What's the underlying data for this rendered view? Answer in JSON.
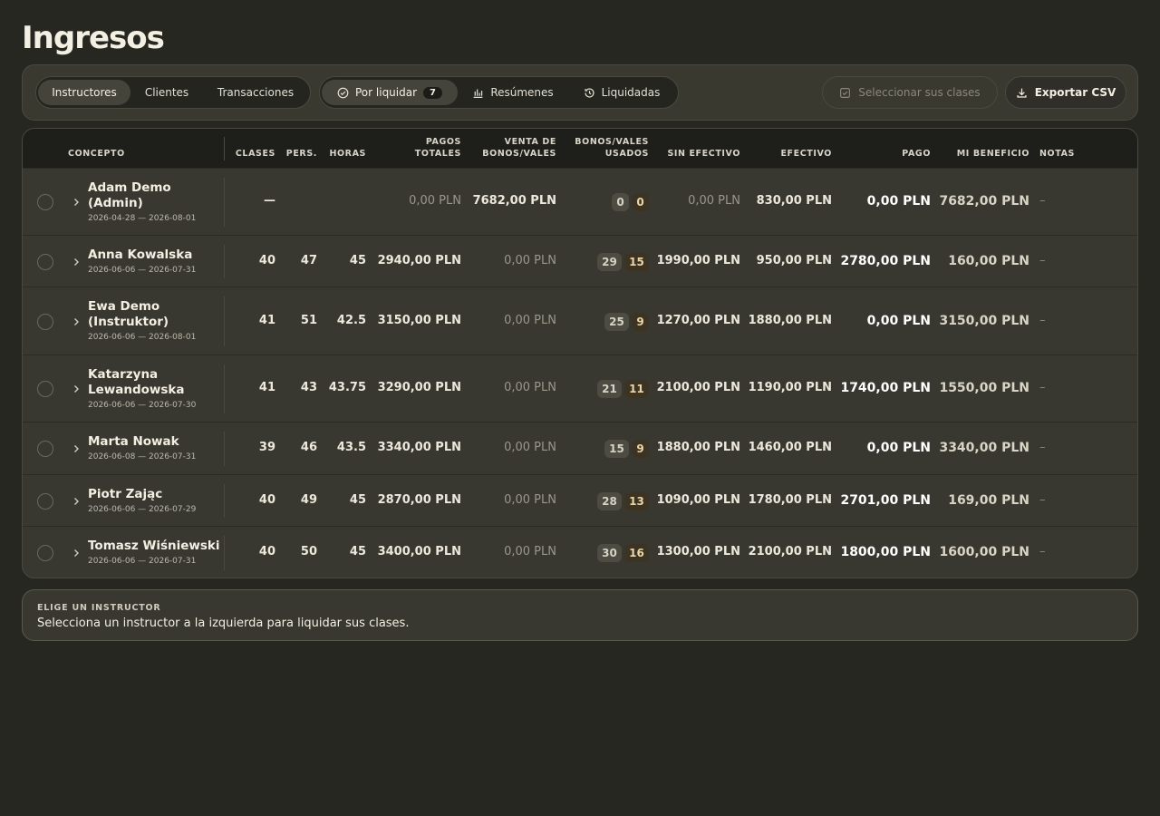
{
  "page": {
    "title": "Ingresos"
  },
  "tabs": {
    "view": [
      "Instructores",
      "Clientes",
      "Transacciones"
    ],
    "status": [
      {
        "label": "Por liquidar",
        "icon": "check-circle-icon",
        "count": "7"
      },
      {
        "label": "Resúmenes",
        "icon": "bar-chart-icon"
      },
      {
        "label": "Liquidadas",
        "icon": "history-icon"
      }
    ]
  },
  "actions": {
    "select_label": "Seleccionar sus clases",
    "export_label": "Exportar CSV"
  },
  "table": {
    "headers": {
      "concepto": "CONCEPTO",
      "clases": "CLASES",
      "pers": "PERS.",
      "horas": "HORAS",
      "pagos": [
        "PAGOS",
        "TOTALES"
      ],
      "venta": [
        "VENTA DE",
        "BONOS/VALES"
      ],
      "usados": [
        "BONOS/VALES",
        "USADOS"
      ],
      "sin_efectivo": "SIN EFECTIVO",
      "efectivo": "EFECTIVO",
      "pago": "PAGO",
      "beneficio": "MI BENEFICIO",
      "notas": "NOTAS"
    },
    "rows": [
      {
        "name": "Adam Demo (Admin)",
        "dates": "2026-04-28 — 2026-08-01",
        "clases": "—",
        "pers": "",
        "horas": "",
        "pagos": "0,00 PLN",
        "venta": "7682,00 PLN",
        "usados_a": "0",
        "usados_b": "0",
        "sin_efectivo": "0,00 PLN",
        "efectivo": "830,00 PLN",
        "pago": "0,00 PLN",
        "beneficio": "7682,00 PLN",
        "notas": "–"
      },
      {
        "name": "Anna Kowalska",
        "dates": "2026-06-06 — 2026-07-31",
        "clases": "40",
        "pers": "47",
        "horas": "45",
        "pagos": "2940,00 PLN",
        "venta": "0,00 PLN",
        "usados_a": "29",
        "usados_b": "15",
        "sin_efectivo": "1990,00 PLN",
        "efectivo": "950,00 PLN",
        "pago": "2780,00 PLN",
        "beneficio": "160,00 PLN",
        "notas": "–"
      },
      {
        "name": "Ewa Demo (Instruktor)",
        "dates": "2026-06-06 — 2026-08-01",
        "clases": "41",
        "pers": "51",
        "horas": "42.5",
        "pagos": "3150,00 PLN",
        "venta": "0,00 PLN",
        "usados_a": "25",
        "usados_b": "9",
        "sin_efectivo": "1270,00 PLN",
        "efectivo": "1880,00 PLN",
        "pago": "0,00 PLN",
        "beneficio": "3150,00 PLN",
        "notas": "–"
      },
      {
        "name": "Katarzyna Lewandowska",
        "dates": "2026-06-06 — 2026-07-30",
        "clases": "41",
        "pers": "43",
        "horas": "43.75",
        "pagos": "3290,00 PLN",
        "venta": "0,00 PLN",
        "usados_a": "21",
        "usados_b": "11",
        "sin_efectivo": "2100,00 PLN",
        "efectivo": "1190,00 PLN",
        "pago": "1740,00 PLN",
        "beneficio": "1550,00 PLN",
        "notas": "–"
      },
      {
        "name": "Marta Nowak",
        "dates": "2026-06-08 — 2026-07-31",
        "clases": "39",
        "pers": "46",
        "horas": "43.5",
        "pagos": "3340,00 PLN",
        "venta": "0,00 PLN",
        "usados_a": "15",
        "usados_b": "9",
        "sin_efectivo": "1880,00 PLN",
        "efectivo": "1460,00 PLN",
        "pago": "0,00 PLN",
        "beneficio": "3340,00 PLN",
        "notas": "–"
      },
      {
        "name": "Piotr Zając",
        "dates": "2026-06-06 — 2026-07-29",
        "clases": "40",
        "pers": "49",
        "horas": "45",
        "pagos": "2870,00 PLN",
        "venta": "0,00 PLN",
        "usados_a": "28",
        "usados_b": "13",
        "sin_efectivo": "1090,00 PLN",
        "efectivo": "1780,00 PLN",
        "pago": "2701,00 PLN",
        "beneficio": "169,00 PLN",
        "notas": "–"
      },
      {
        "name": "Tomasz Wiśniewski",
        "dates": "2026-06-06 — 2026-07-31",
        "clases": "40",
        "pers": "50",
        "horas": "45",
        "pagos": "3400,00 PLN",
        "venta": "0,00 PLN",
        "usados_a": "30",
        "usados_b": "16",
        "sin_efectivo": "1300,00 PLN",
        "efectivo": "2100,00 PLN",
        "pago": "1800,00 PLN",
        "beneficio": "1600,00 PLN",
        "notas": "–"
      }
    ]
  },
  "info": {
    "label": "ELIGE UN INSTRUCTOR",
    "text": "Selecciona un instructor a la izquierda para liquidar sus clases."
  }
}
